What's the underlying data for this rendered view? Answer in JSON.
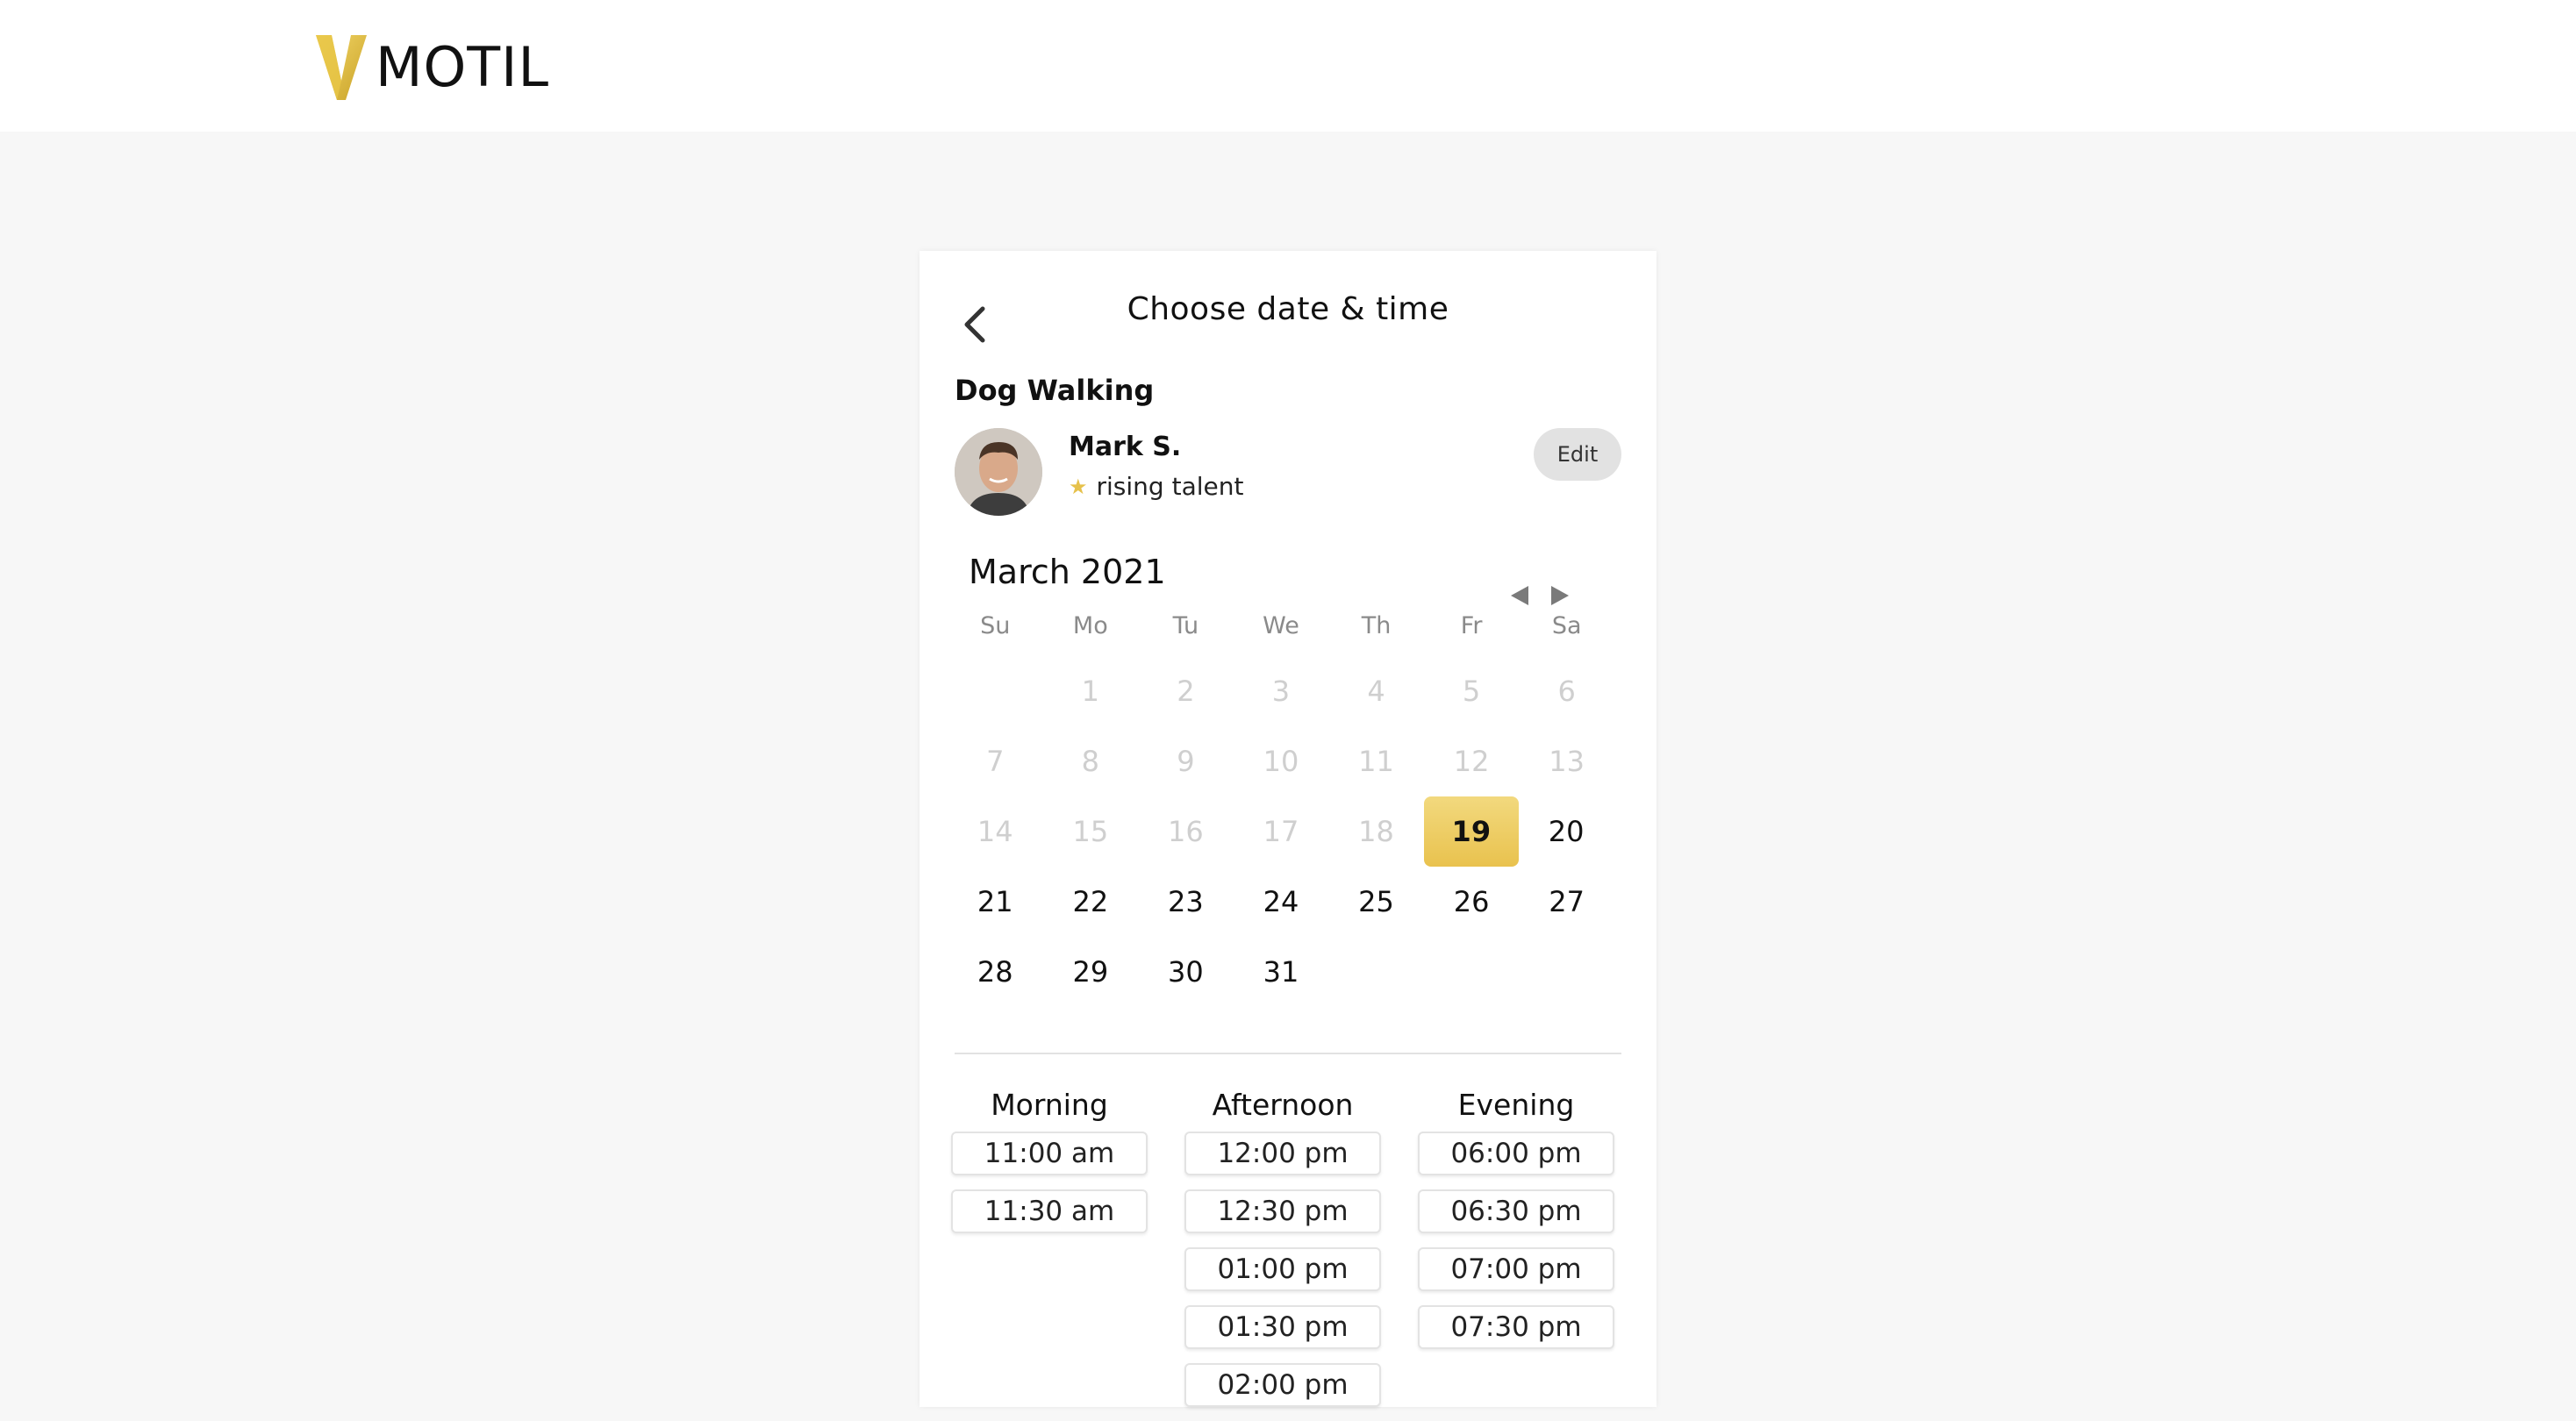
{
  "brand": {
    "name": "MOTIL",
    "accent": "#e9c24e"
  },
  "page": {
    "title": "Choose date & time"
  },
  "booking": {
    "service": "Dog Walking",
    "walker_name": "Mark S.",
    "badge": "rising talent",
    "edit_label": "Edit"
  },
  "calendar": {
    "month_label": "March 2021",
    "weekdays": [
      "Su",
      "Mo",
      "Tu",
      "We",
      "Th",
      "Fr",
      "Sa"
    ],
    "weeks": [
      [
        "",
        "1",
        "2",
        "3",
        "4",
        "5",
        "6"
      ],
      [
        "7",
        "8",
        "9",
        "10",
        "11",
        "12",
        "13"
      ],
      [
        "14",
        "15",
        "16",
        "17",
        "18",
        "19",
        "20"
      ],
      [
        "21",
        "22",
        "23",
        "24",
        "25",
        "26",
        "27"
      ],
      [
        "28",
        "29",
        "30",
        "31",
        "",
        "",
        ""
      ]
    ],
    "selected_day": "19",
    "first_available_day": 19
  },
  "timeslots": {
    "morning": {
      "label": "Morning",
      "slots": [
        "11:00 am",
        "11:30 am"
      ]
    },
    "afternoon": {
      "label": "Afternoon",
      "slots": [
        "12:00 pm",
        "12:30 pm",
        "01:00 pm",
        "01:30 pm",
        "02:00 pm"
      ]
    },
    "evening": {
      "label": "Evening",
      "slots": [
        "06:00 pm",
        "06:30 pm",
        "07:00 pm",
        "07:30 pm"
      ]
    }
  }
}
